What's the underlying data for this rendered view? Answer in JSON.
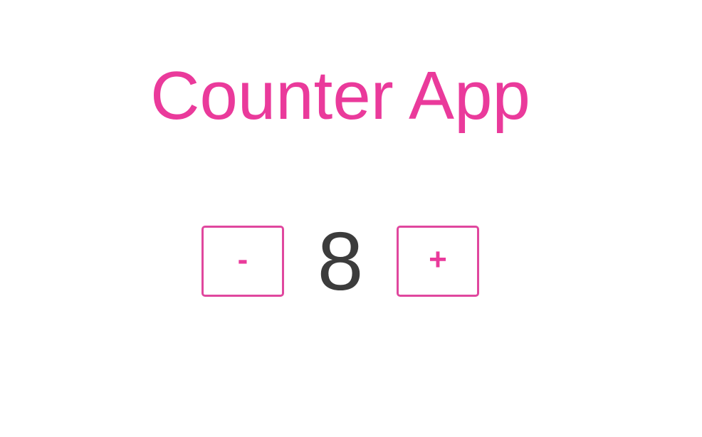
{
  "app": {
    "title": "Counter App"
  },
  "counter": {
    "decrement_label": "-",
    "value": "8",
    "increment_label": "+"
  },
  "colors": {
    "accent": "#ea3a9b",
    "button_border": "#e0479e",
    "value_text": "#3c3c3c",
    "background": "#ffffff"
  }
}
